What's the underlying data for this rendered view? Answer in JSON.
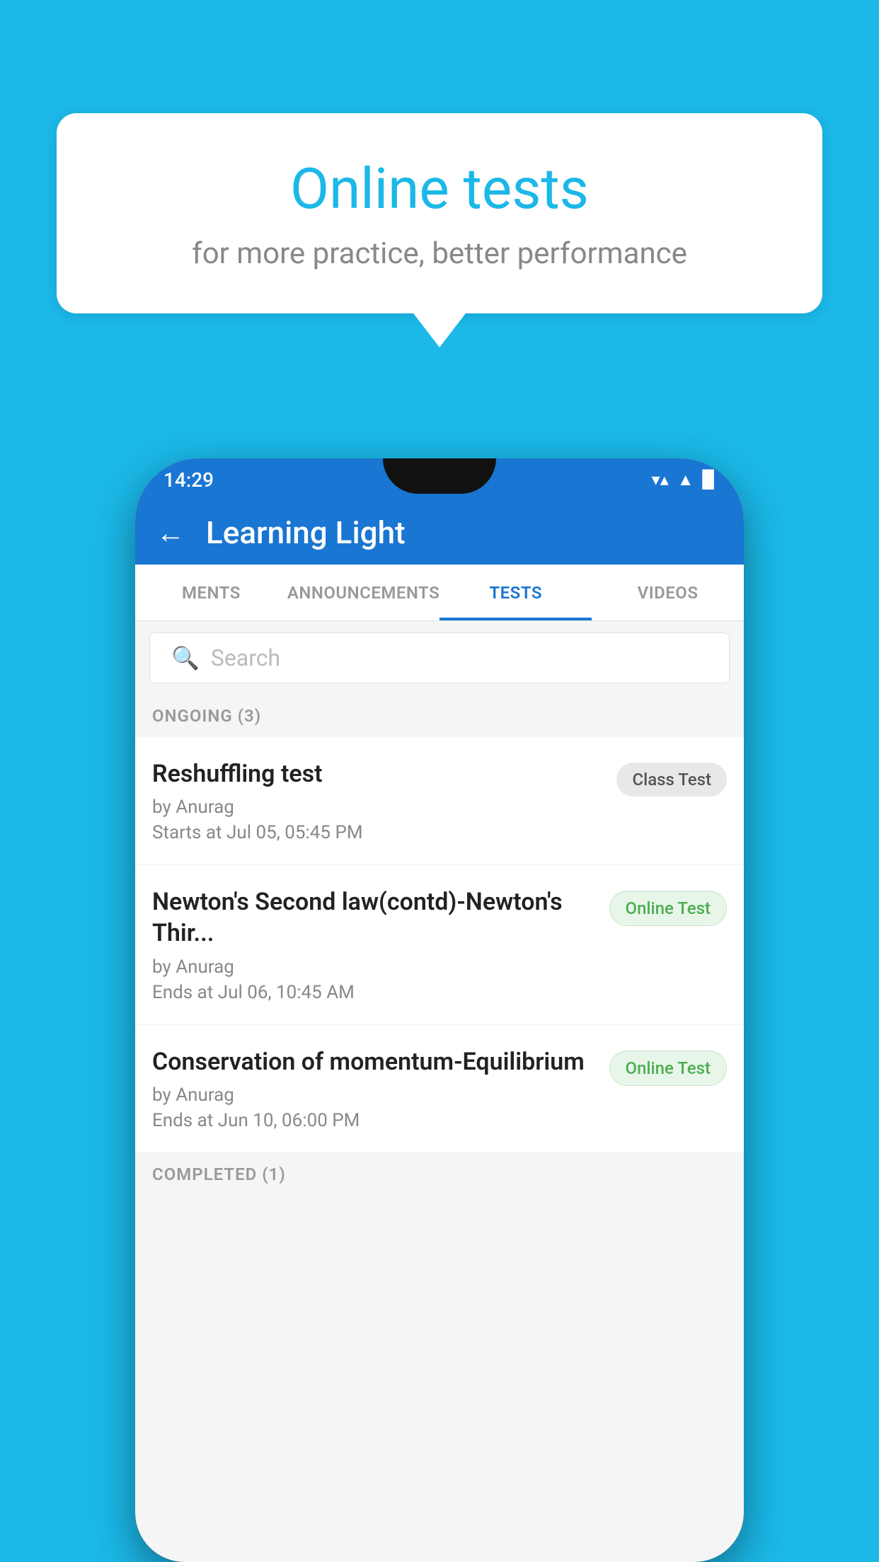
{
  "background": {
    "color": "#1BB8E8"
  },
  "speech_bubble": {
    "title": "Online tests",
    "subtitle": "for more practice, better performance"
  },
  "status_bar": {
    "time": "14:29",
    "wifi": "▼",
    "signal": "▲",
    "battery": "▉"
  },
  "app_bar": {
    "back_label": "←",
    "title": "Learning Light"
  },
  "tabs": [
    {
      "label": "MENTS",
      "active": false
    },
    {
      "label": "ANNOUNCEMENTS",
      "active": false
    },
    {
      "label": "TESTS",
      "active": true
    },
    {
      "label": "VIDEOS",
      "active": false
    }
  ],
  "search": {
    "placeholder": "Search"
  },
  "ongoing_section": {
    "label": "ONGOING (3)"
  },
  "tests": [
    {
      "name": "Reshuffling test",
      "author": "by Anurag",
      "time_label": "Starts at",
      "time": "Jul 05, 05:45 PM",
      "badge": "Class Test",
      "badge_type": "class"
    },
    {
      "name": "Newton's Second law(contd)-Newton's Thir...",
      "author": "by Anurag",
      "time_label": "Ends at",
      "time": "Jul 06, 10:45 AM",
      "badge": "Online Test",
      "badge_type": "online"
    },
    {
      "name": "Conservation of momentum-Equilibrium",
      "author": "by Anurag",
      "time_label": "Ends at",
      "time": "Jun 10, 06:00 PM",
      "badge": "Online Test",
      "badge_type": "online"
    }
  ],
  "completed_section": {
    "label": "COMPLETED (1)"
  }
}
